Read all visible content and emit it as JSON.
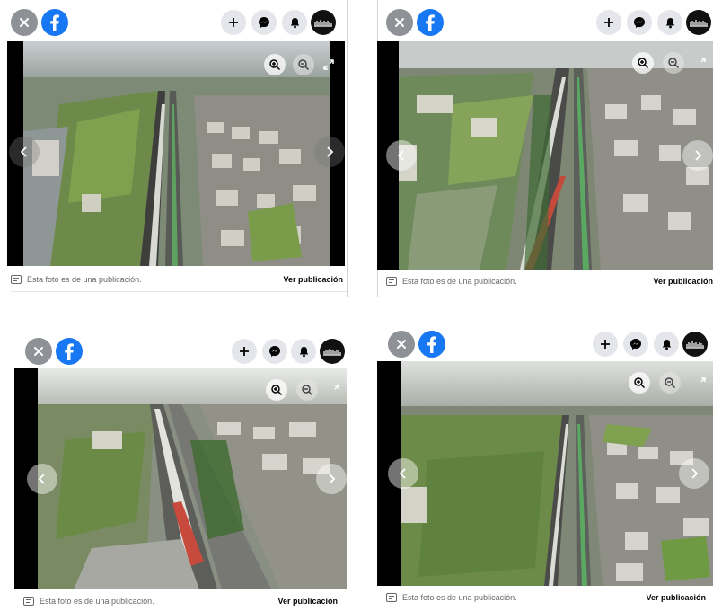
{
  "panels": [
    {
      "footer_text": "Esta foto es de una publicación.",
      "footer_link": "Ver publicación"
    },
    {
      "footer_text": "Esta foto es de una publicación.",
      "footer_link": "Ver publicación"
    },
    {
      "footer_text": "Esta foto es de una publicación.",
      "footer_link": "Ver publicación"
    },
    {
      "footer_text": "Esta foto es de una publicación.",
      "footer_link": "Ver publicación"
    }
  ],
  "icons": {
    "close": "close-icon",
    "brand": "facebook-logo-icon",
    "add": "plus-icon",
    "messenger": "messenger-icon",
    "notifications": "bell-icon",
    "avatar": "profile-avatar",
    "zoom_in": "zoom-in-icon",
    "zoom_out": "zoom-out-icon",
    "fullscreen": "fullscreen-icon",
    "prev": "chevron-left-icon",
    "next": "chevron-right-icon"
  },
  "colors": {
    "facebook_blue": "#1877f2",
    "close_grey": "#8e9196",
    "action_bg": "#e4e6eb",
    "photo_letterbox": "#000000"
  }
}
